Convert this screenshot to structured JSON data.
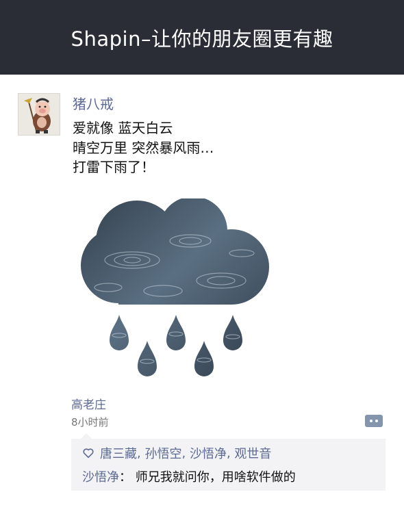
{
  "header": {
    "title": "Shapin–让你的朋友圈更有趣"
  },
  "post": {
    "author": "猪八戒",
    "lines": [
      "爱就像 蓝天白云",
      "晴空万里 突然暴风雨…",
      "打雷下雨了！"
    ],
    "location": "高老庄",
    "time": "8小时前"
  },
  "likes": {
    "names": [
      "唐三藏",
      "孙悟空",
      "沙悟净",
      "观世音"
    ],
    "separator": ","
  },
  "comments": [
    {
      "author": "沙悟净",
      "colon": "：",
      "text": "师兄我就问你，用啥软件做的"
    }
  ],
  "colors": {
    "header_bg": "#2a2d35",
    "link": "#5b6a93",
    "panel_bg": "#f3f3f5"
  },
  "icons": {
    "like": "heart-icon",
    "comment": "comment-icon",
    "avatar": "pig-avatar"
  }
}
